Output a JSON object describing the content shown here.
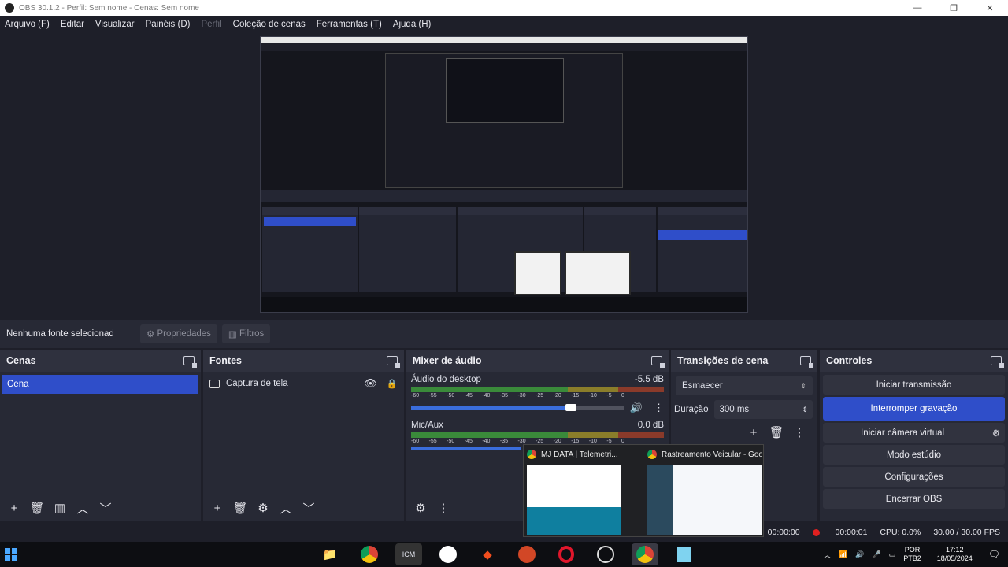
{
  "window": {
    "title": "OBS 30.1.2 - Perfil: Sem nome - Cenas: Sem nome",
    "controls": [
      "—",
      "❐",
      "✕"
    ]
  },
  "menu": [
    "Arquivo (F)",
    "Editar",
    "Visualizar",
    "Painéis (D)",
    "Perfil",
    "Coleção de cenas",
    "Ferramentas (T)",
    "Ajuda (H)"
  ],
  "source_bar": {
    "label": "Nenhuma fonte selecionad",
    "properties": "Propriedades",
    "filters": "Filtros"
  },
  "scenes": {
    "title": "Cenas",
    "items": [
      "Cena"
    ]
  },
  "sources": {
    "title": "Fontes",
    "items": [
      "Captura de tela"
    ]
  },
  "mixer": {
    "title": "Mixer de áudio",
    "channels": [
      {
        "name": "Áudio do desktop",
        "db": "-5.5 dB"
      },
      {
        "name": "Mic/Aux",
        "db": "0.0 dB"
      }
    ],
    "ticks": [
      "-60",
      "-55",
      "-50",
      "-45",
      "-40",
      "-35",
      "-30",
      "-25",
      "-20",
      "-15",
      "-10",
      "-5",
      "0"
    ]
  },
  "transitions": {
    "title": "Transições de cena",
    "selected": "Esmaecer",
    "duration_label": "Duração",
    "duration_value": "300 ms"
  },
  "controls": {
    "title": "Controles",
    "buttons": [
      "Iniciar transmissão",
      "Interromper gravação",
      "Iniciar câmera virtual",
      "Modo estúdio",
      "Configurações",
      "Encerrar OBS"
    ]
  },
  "status": {
    "stream_time": "00:00:00",
    "rec_time": "00:00:01",
    "cpu": "CPU: 0.0%",
    "fps": "30.00 / 30.00 FPS"
  },
  "popup": {
    "tabs": [
      "MJ DATA | Telemetri...",
      "Rastreamento Veicular - Google..."
    ]
  },
  "taskbar": {
    "lang_top": "POR",
    "lang_bottom": "PTB2",
    "time": "17:12",
    "date": "18/05/2024"
  }
}
